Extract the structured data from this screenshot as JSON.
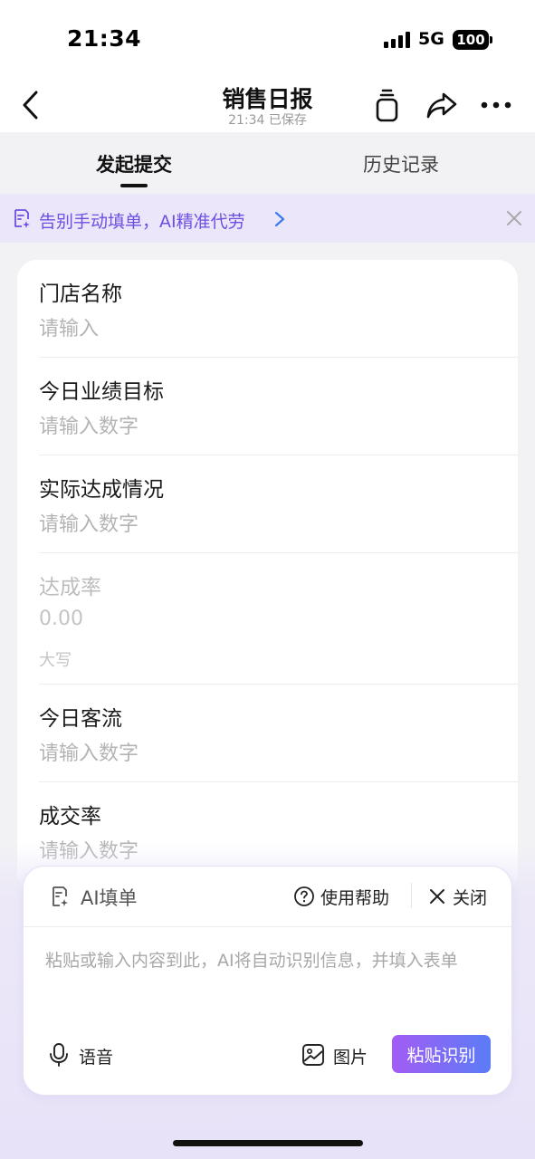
{
  "status_bar": {
    "time": "21:34",
    "network": "5G",
    "battery": "100"
  },
  "nav": {
    "title": "销售日报",
    "subtitle": "21:34 已保存"
  },
  "tabs": [
    {
      "label": "发起提交",
      "active": true
    },
    {
      "label": "历史记录",
      "active": false
    }
  ],
  "banner": {
    "text": "告别手动填单，AI精准代劳"
  },
  "form": {
    "fields": [
      {
        "label": "门店名称",
        "placeholder": "请输入",
        "value": ""
      },
      {
        "label": "今日业绩目标",
        "placeholder": "请输入数字",
        "value": ""
      },
      {
        "label": "实际达成情况",
        "placeholder": "请输入数字",
        "value": ""
      },
      {
        "label": "达成率",
        "value": "0.00",
        "caption": "大写",
        "disabled": true
      },
      {
        "label": "今日客流",
        "placeholder": "请输入数字",
        "value": ""
      },
      {
        "label": "成交率",
        "placeholder": "请输入数字",
        "value": ""
      }
    ]
  },
  "ai_panel": {
    "title": "AI填单",
    "help_label": "使用帮助",
    "close_label": "关闭",
    "input_placeholder": "粘贴或输入内容到此，AI将自动识别信息，并填入表单",
    "input_value": "",
    "voice_label": "语音",
    "image_label": "图片",
    "paste_button_label": "粘贴识别"
  },
  "colors": {
    "accent": "#6e4fe0",
    "button_gradient_start": "#a35cf5",
    "button_gradient_end": "#5b7cf7"
  }
}
